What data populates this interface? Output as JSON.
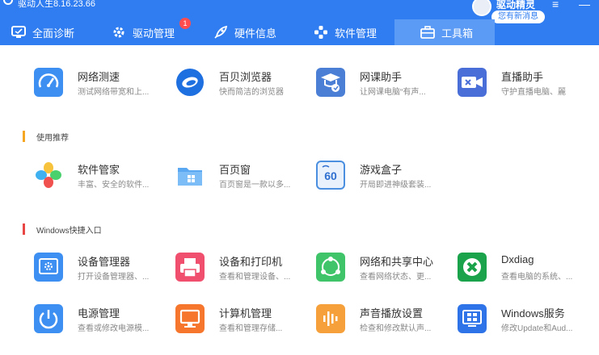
{
  "app": {
    "title": "驱动人生8.16.23.66"
  },
  "user": {
    "name": "驱动精灵",
    "message_pill": "您有新消息"
  },
  "window_controls": {
    "menu": "≡",
    "minimize": "—"
  },
  "tabs": [
    {
      "label": "全面诊断",
      "icon": "monitor-icon",
      "active": false
    },
    {
      "label": "驱动管理",
      "icon": "gear-icon",
      "active": false,
      "badge": "1"
    },
    {
      "label": "硬件信息",
      "icon": "rocket-icon",
      "active": false
    },
    {
      "label": "软件管理",
      "icon": "apps-icon",
      "active": false
    },
    {
      "label": "工具箱",
      "icon": "toolbox-icon",
      "active": true
    }
  ],
  "top_tools": [
    {
      "name": "网络测速",
      "desc": "测试网络带宽和上...",
      "icon": "speedometer-icon"
    },
    {
      "name": "百贝浏览器",
      "desc": "快而简洁的浏览器",
      "icon": "browser-icon"
    },
    {
      "name": "网课助手",
      "desc": "让网课电脑“有声...",
      "icon": "graduation-icon"
    },
    {
      "name": "直播助手",
      "desc": "守护直播电脑、麗",
      "icon": "video-icon"
    }
  ],
  "sections": {
    "recommend": {
      "title": "使用推荐",
      "accent": "#f5a623"
    },
    "windows": {
      "title": "Windows快捷入口",
      "accent": "#e84545"
    }
  },
  "recommend_tools": [
    {
      "name": "软件管家",
      "desc": "丰富、安全的软件...",
      "icon": "flower-icon"
    },
    {
      "name": "百页窗",
      "desc": "百页窗是一款以多...",
      "icon": "folder-icon"
    },
    {
      "name": "游戏盒子",
      "desc": "开局即进神级套装...",
      "icon": "gamebox-icon"
    }
  ],
  "windows_tools": [
    {
      "name": "设备管理器",
      "desc": "打开设备管理器、...",
      "icon": "device-manager-icon"
    },
    {
      "name": "设备和打印机",
      "desc": "查看和管理设备、...",
      "icon": "printer-icon"
    },
    {
      "name": "网络和共享中心",
      "desc": "查看网络状态、更...",
      "icon": "share-icon"
    },
    {
      "name": "Dxdiag",
      "desc": "查看电脑的系统、...",
      "icon": "dxdiag-icon"
    },
    {
      "name": "电源管理",
      "desc": "查看或修改电源模...",
      "icon": "power-icon"
    },
    {
      "name": "计算机管理",
      "desc": "查看和管理存储...",
      "icon": "computer-icon"
    },
    {
      "name": "声音播放设置",
      "desc": "检查和修改默认声...",
      "icon": "sound-icon"
    },
    {
      "name": "Windows服务",
      "desc": "修改Update和Aud...",
      "icon": "windows-service-icon"
    }
  ],
  "colors": {
    "header_blue": "#2f7df0",
    "active_tab": "#5b9bf5",
    "badge_red": "#ff4d4f"
  }
}
